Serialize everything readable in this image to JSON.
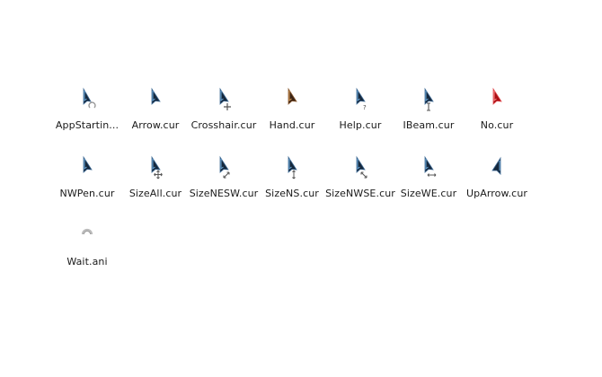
{
  "folder": {
    "files": [
      {
        "name": "AppStartin...",
        "icon": "appstarting-cursor-icon",
        "color": "#16283c"
      },
      {
        "name": "Arrow.cur",
        "icon": "arrow-cursor-icon",
        "color": "#16283c"
      },
      {
        "name": "Crosshair.cur",
        "icon": "crosshair-cursor-icon",
        "color": "#16283c"
      },
      {
        "name": "Hand.cur",
        "icon": "hand-cursor-icon",
        "color": "#6a3a1c"
      },
      {
        "name": "Help.cur",
        "icon": "help-cursor-icon",
        "color": "#16283c"
      },
      {
        "name": "IBeam.cur",
        "icon": "ibeam-cursor-icon",
        "color": "#16283c"
      },
      {
        "name": "No.cur",
        "icon": "no-cursor-icon",
        "color": "#c8161c"
      },
      {
        "name": "NWPen.cur",
        "icon": "nwpen-cursor-icon",
        "color": "#16283c"
      },
      {
        "name": "SizeAll.cur",
        "icon": "sizeall-cursor-icon",
        "color": "#16283c"
      },
      {
        "name": "SizeNESW.cur",
        "icon": "sizenesw-cursor-icon",
        "color": "#16283c"
      },
      {
        "name": "SizeNS.cur",
        "icon": "sizens-cursor-icon",
        "color": "#16283c"
      },
      {
        "name": "SizeNWSE.cur",
        "icon": "sizenwse-cursor-icon",
        "color": "#16283c"
      },
      {
        "name": "SizeWE.cur",
        "icon": "sizewe-cursor-icon",
        "color": "#16283c"
      },
      {
        "name": "UpArrow.cur",
        "icon": "uparrow-cursor-icon",
        "color": "#16283c"
      },
      {
        "name": "Wait.ani",
        "icon": "wait-cursor-icon",
        "color": "#888888"
      }
    ]
  }
}
